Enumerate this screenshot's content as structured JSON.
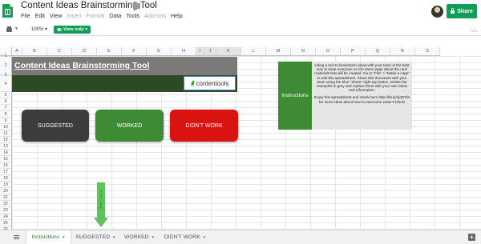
{
  "header": {
    "title": "Content Ideas Brainstorming Tool",
    "menu": [
      "File",
      "Edit",
      "View",
      "Insert",
      "Format",
      "Data",
      "Tools",
      "Add-ons",
      "Help"
    ],
    "share_label": "Share"
  },
  "toolbar": {
    "zoom": "100%",
    "view_only_label": "View only"
  },
  "grid": {
    "columns": [
      "A",
      "B",
      "C",
      "D",
      "E",
      "F",
      "G",
      "H",
      "I",
      "J",
      "K",
      "L",
      "M",
      "N",
      "O",
      "P",
      "Q",
      "R",
      "S"
    ],
    "rows": [
      "1",
      "2",
      "3",
      "4",
      "5",
      "6",
      "7",
      "8",
      "9",
      "10",
      "11",
      "12",
      "13",
      "14",
      "15",
      "16",
      "17",
      "18",
      "19",
      "20",
      "21",
      "22",
      "23",
      "24",
      "25",
      "26"
    ]
  },
  "sheet": {
    "title": "Content Ideas Brainstorming Tool",
    "logo_text": "contentools",
    "buttons": {
      "suggested": "SUGGESTED",
      "worked": "WORKED",
      "didnt_work": "DIDN'T WORK"
    },
    "arrow_text": "START HERE",
    "instructions_label": "Instructions",
    "instructions_p1": "Using a tool to brainstorm ideas with your team is the best way to keep everyone on the same page about the next materials that will be created. Go to \"File\" > \"Make a copy\" to edit this spreadsheet. Share this document with your team using the blue \"Share\" right top button. Delete the examples in grey and replace them with your own ideas and information.",
    "instructions_p2": "Enjoy this spreadsheet and check here http://bit.ly/1jeBTlis for more ideas about how to overcome writer's block!"
  },
  "tabs": [
    {
      "label": "Instructions"
    },
    {
      "label": "SUGGESTED"
    },
    {
      "label": "WORKED"
    },
    {
      "label": "DIDN'T WORK"
    }
  ],
  "colors": {
    "brand_green": "#0f9d58",
    "title_gray": "#7c7979",
    "title_dark_green": "#2e4a25",
    "worked_green": "#3e8a35",
    "didnt_red": "#d9130f",
    "suggested_dark": "#3c3c3c",
    "arrow_green": "#5ec35c"
  }
}
